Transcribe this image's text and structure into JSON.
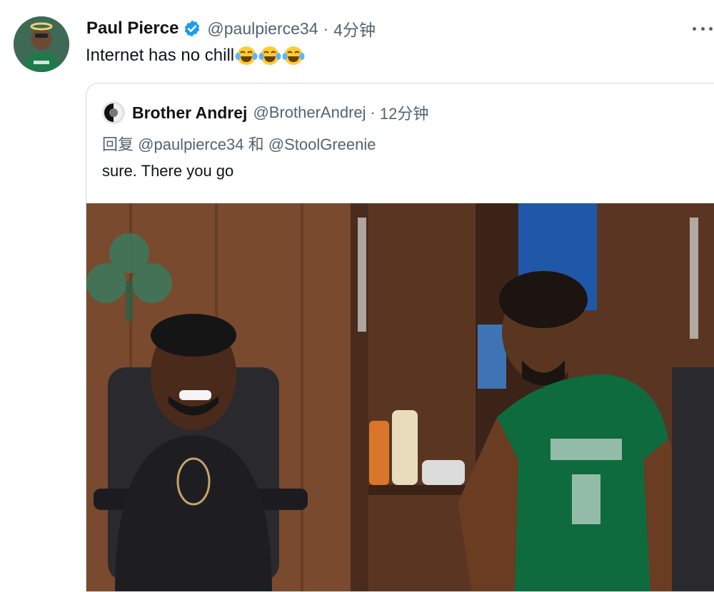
{
  "tweet": {
    "display_name": "Paul Pierce",
    "handle": "@paulpierce34",
    "separator": "·",
    "time": "4分钟",
    "text": "Internet has no chill",
    "emojis": [
      "face-with-tears-of-joy",
      "face-with-tears-of-joy",
      "face-with-tears-of-joy"
    ],
    "verified_icon": "verified-badge-icon",
    "more_icon": "more-options-icon"
  },
  "quoted_tweet": {
    "display_name": "Brother Andrej",
    "handle": "@BrotherAndrej",
    "separator": "·",
    "time": "12分钟",
    "reply_prefix": "回复",
    "mention_1": "@paulpierce34",
    "conjunction": "和",
    "mention_2": "@StoolGreenie",
    "text": "sure. There you go",
    "media_description_icon": "photo-locker-room"
  },
  "colors": {
    "text_primary": "#0f1419",
    "text_secondary": "#536471",
    "verified_blue": "#1d9bf0",
    "border": "#cfd9de"
  }
}
